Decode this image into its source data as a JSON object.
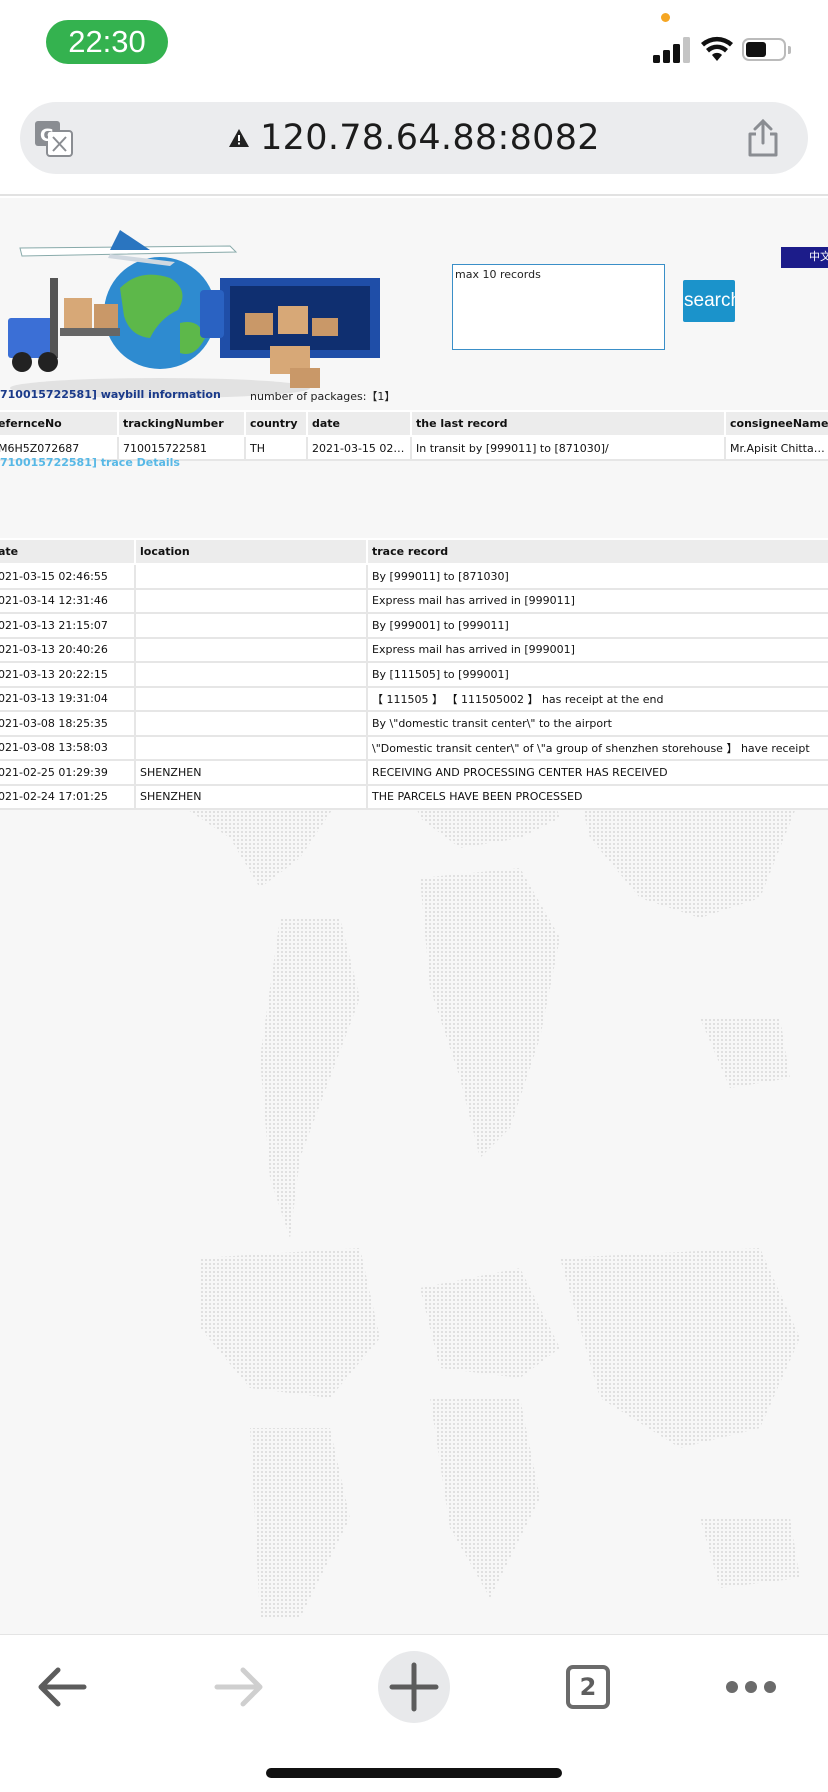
{
  "status_bar": {
    "time": "22:30"
  },
  "browser": {
    "url": "120.78.64.88:8082",
    "tab_count": "2"
  },
  "page": {
    "search": {
      "placeholder": "max 10 records",
      "button_label": "search"
    },
    "language_toggle": "中文",
    "waybill_info": {
      "title": "710015722581] waybill information",
      "packages_label": "number of packages:【1】",
      "columns": [
        "efernceNo",
        "trackingNumber",
        "country",
        "date",
        "the last record",
        "consigneeName"
      ],
      "row": [
        "M6H5Z072687",
        "710015722581",
        "TH",
        "2021-03-15 02:...",
        "In transit by [999011] to [871030]/",
        "Mr.Apisit Chittasiri"
      ]
    },
    "trace_details": {
      "title": "710015722581] trace Details",
      "columns": [
        "ate",
        "location",
        "trace record"
      ],
      "rows": [
        [
          "021-03-15 02:46:55",
          "",
          "By [999011] to [871030]"
        ],
        [
          "021-03-14 12:31:46",
          "",
          "Express mail has arrived in [999011]"
        ],
        [
          "021-03-13 21:15:07",
          "",
          "By [999001] to [999011]"
        ],
        [
          "021-03-13 20:40:26",
          "",
          "Express mail has arrived in [999001]"
        ],
        [
          "021-03-13 20:22:15",
          "",
          "By [111505] to [999001]"
        ],
        [
          "021-03-13 19:31:04",
          "",
          "【 111505 】 【 111505002 】 has receipt at the end"
        ],
        [
          "021-03-08 18:25:35",
          "",
          "By \\\"domestic transit center\\\" to the airport"
        ],
        [
          "021-03-08 13:58:03",
          "",
          "\\\"Domestic transit center\\\" of \\\"a group of shenzhen storehouse 】 have receipt"
        ],
        [
          "021-02-25 01:29:39",
          "SHENZHEN",
          "RECEIVING AND PROCESSING CENTER HAS RECEIVED"
        ],
        [
          "021-02-24 17:01:25",
          "SHENZHEN",
          "THE PARCELS HAVE BEEN PROCESSED"
        ]
      ]
    }
  },
  "icons": {
    "translate": "translate-icon",
    "warning": "warning-icon",
    "share": "share-icon",
    "back": "arrow-left-icon",
    "forward": "arrow-right-icon",
    "new_tab": "plus-icon",
    "more": "more-dots-icon"
  },
  "colors": {
    "time_pill": "#34b24f",
    "search_button": "#1b93cb",
    "waybill_title": "#1a3a8a",
    "trace_title": "#57b8e6",
    "language_toggle": "#1c1c8a"
  }
}
